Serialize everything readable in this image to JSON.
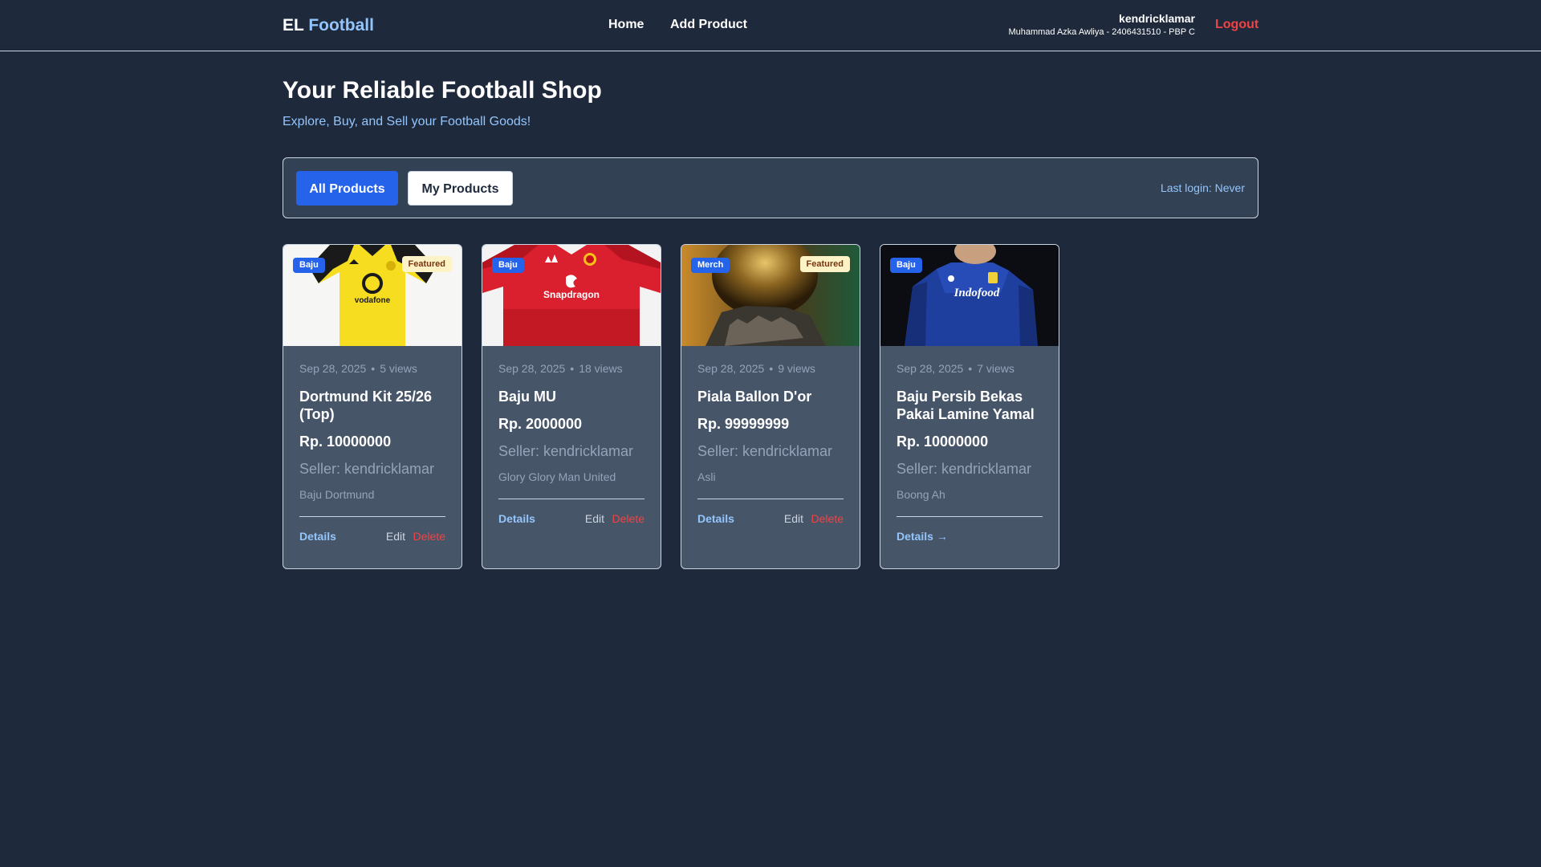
{
  "nav": {
    "brand_prefix": "EL",
    "brand_accent": "Football",
    "links": [
      "Home",
      "Add Product"
    ],
    "username": "kendricklamar",
    "user_info": "Muhammad Azka Awliya - 2406431510 - PBP C",
    "logout": "Logout"
  },
  "hero": {
    "title": "Your Reliable Football Shop",
    "subtitle": "Explore, Buy, and Sell your Football Goods!"
  },
  "filters": {
    "all": "All Products",
    "mine": "My Products",
    "last_login": "Last login: Never"
  },
  "products": [
    {
      "category": "Baju",
      "featured": "Featured",
      "date": "Sep 28, 2025",
      "views": "5 views",
      "name": "Dortmund Kit 25/26 (Top)",
      "price": "Rp. 10000000",
      "seller": "Seller: kendricklamar",
      "description": "Baju Dortmund",
      "details": "Details",
      "edit": "Edit",
      "delete": "Delete",
      "sponsor": "vodafone"
    },
    {
      "category": "Baju",
      "date": "Sep 28, 2025",
      "views": "18 views",
      "name": "Baju MU",
      "price": "Rp. 2000000",
      "seller": "Seller: kendricklamar",
      "description": "Glory Glory Man United",
      "details": "Details",
      "edit": "Edit",
      "delete": "Delete",
      "sponsor": "Snapdragon"
    },
    {
      "category": "Merch",
      "featured": "Featured",
      "date": "Sep 28, 2025",
      "views": "9 views",
      "name": "Piala Ballon D'or",
      "price": "Rp. 99999999",
      "seller": "Seller: kendricklamar",
      "description": "Asli",
      "details": "Details",
      "edit": "Edit",
      "delete": "Delete"
    },
    {
      "category": "Baju",
      "date": "Sep 28, 2025",
      "views": "7 views",
      "name": "Baju Persib Bekas Pakai Lamine Yamal",
      "price": "Rp. 10000000",
      "seller": "Seller: kendricklamar",
      "description": "Boong Ah",
      "details": "Details",
      "arrow": "→",
      "sponsor": "Indofood"
    }
  ],
  "colors": {
    "background": "#1e293b",
    "card": "#475569",
    "primary": "#2563eb",
    "accent": "#93c5fd",
    "danger": "#ef4444"
  }
}
